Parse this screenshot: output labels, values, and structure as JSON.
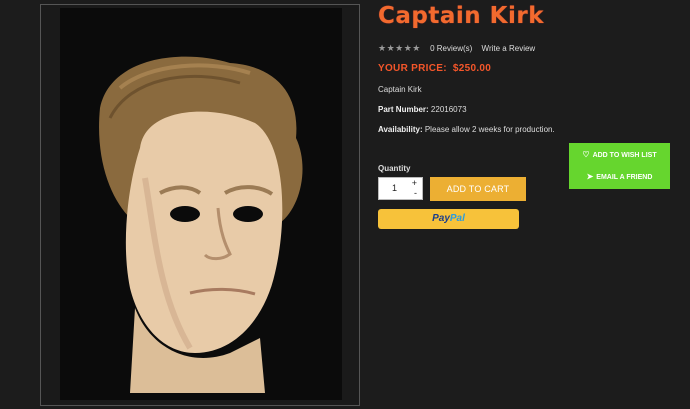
{
  "product": {
    "title": "Captain Kirk",
    "rating": {
      "stars": "★★★★★",
      "reviews_link": "0 Review(s)",
      "write_review_link": "Write a Review"
    },
    "price": {
      "label": "YOUR PRICE:",
      "value": "$250.00"
    },
    "description": "Captain Kirk",
    "part_number": {
      "label": "Part Number:",
      "value": "22016073"
    },
    "availability": {
      "label": "Availability:",
      "value": "Please allow 2 weeks for production."
    }
  },
  "purchase": {
    "quantity_label": "Quantity",
    "quantity_value": "1",
    "increment": "+",
    "decrement": "-",
    "add_to_cart_label": "ADD TO CART",
    "paypal": {
      "part1": "Pay",
      "part2": "Pal"
    }
  },
  "side_actions": {
    "wish_list_label": "ADD TO WISH LIST",
    "wish_icon": "heart-icon",
    "email_label": "EMAIL A FRIEND",
    "email_icon": "paper-plane-icon"
  },
  "colors": {
    "title": "#f26a2e",
    "price": "#f4562a",
    "add_to_cart": "#ecaf33",
    "paypal_bg": "#f7c23a",
    "side_actions_bg": "#66d62e",
    "page_bg": "#1c1c1c"
  }
}
